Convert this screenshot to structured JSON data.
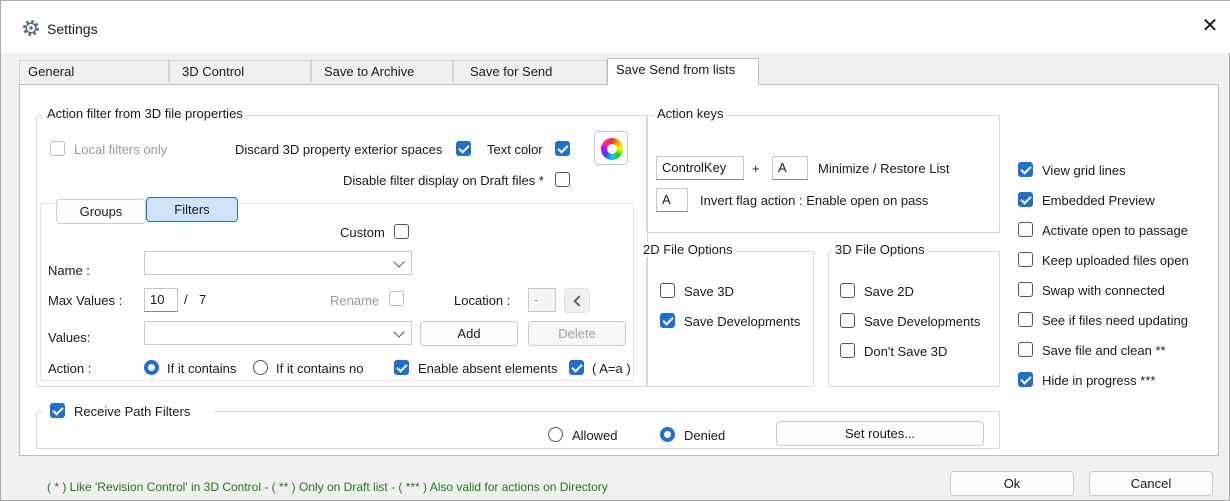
{
  "window": {
    "title": "Settings",
    "close_glyph": "✕"
  },
  "tabs": [
    "General",
    "3D Control",
    "Save to Archive",
    "Save for Send",
    "Save Send from lists"
  ],
  "action_filter": {
    "legend": "Action filter from 3D file properties",
    "local_filters_only": "Local filters only",
    "discard_spaces": "Discard 3D property exterior spaces",
    "text_color": "Text color",
    "disable_filter_draft": "Disable filter display on Draft files *",
    "groups_tab": "Groups",
    "filters_tab": "Filters",
    "custom": "Custom",
    "name_label": "Name :",
    "max_values_label": "Max Values :",
    "max_values_value": "10",
    "max_values_sep": "/",
    "max_values_total": "7",
    "rename": "Rename",
    "location_label": "Location :",
    "location_value": "-",
    "values_label": "Values:",
    "add_button": "Add",
    "delete_button": "Delete",
    "action_label": "Action :",
    "if_contains": "If it contains",
    "if_contains_no": "If it contains no",
    "enable_absent": "Enable absent elements",
    "case_label": "( A=a )"
  },
  "action_keys": {
    "legend": "Action keys",
    "key1": "ControlKey",
    "plus": "+",
    "key2": "A",
    "minimize_restore": "Minimize / Restore List",
    "invert_key": "A",
    "invert_label": "Invert flag action : Enable open on pass"
  },
  "file2d": {
    "legend": "2D File Options",
    "save_3d": "Save 3D",
    "save_dev": "Save Developments"
  },
  "file3d": {
    "legend": "3D File Options",
    "save_2d": "Save 2D",
    "save_dev": "Save Developments",
    "dont_save_3d": "Don't Save 3D"
  },
  "right_options": [
    {
      "label": "View grid lines",
      "checked": true
    },
    {
      "label": "Embedded Preview",
      "checked": true
    },
    {
      "label": "Activate open to passage",
      "checked": false
    },
    {
      "label": "Keep uploaded files open",
      "checked": false
    },
    {
      "label": "Swap with connected",
      "checked": false
    },
    {
      "label": "See if files need updating",
      "checked": false
    },
    {
      "label": "Save file and clean **",
      "checked": false
    },
    {
      "label": "Hide in progress ***",
      "checked": true
    }
  ],
  "path_filters": {
    "legend": "Receive Path Filters",
    "allowed": "Allowed",
    "denied": "Denied",
    "set_routes": "Set routes..."
  },
  "footer": {
    "note": "( * ) Like 'Revision Control' in 3D Control - ( ** ) Only on Draft list - ( *** ) Also valid for actions on Directory",
    "ok": "Ok",
    "cancel": "Cancel"
  },
  "colors": {
    "accent": "#1f6fd0",
    "note_green": "#217a17"
  }
}
